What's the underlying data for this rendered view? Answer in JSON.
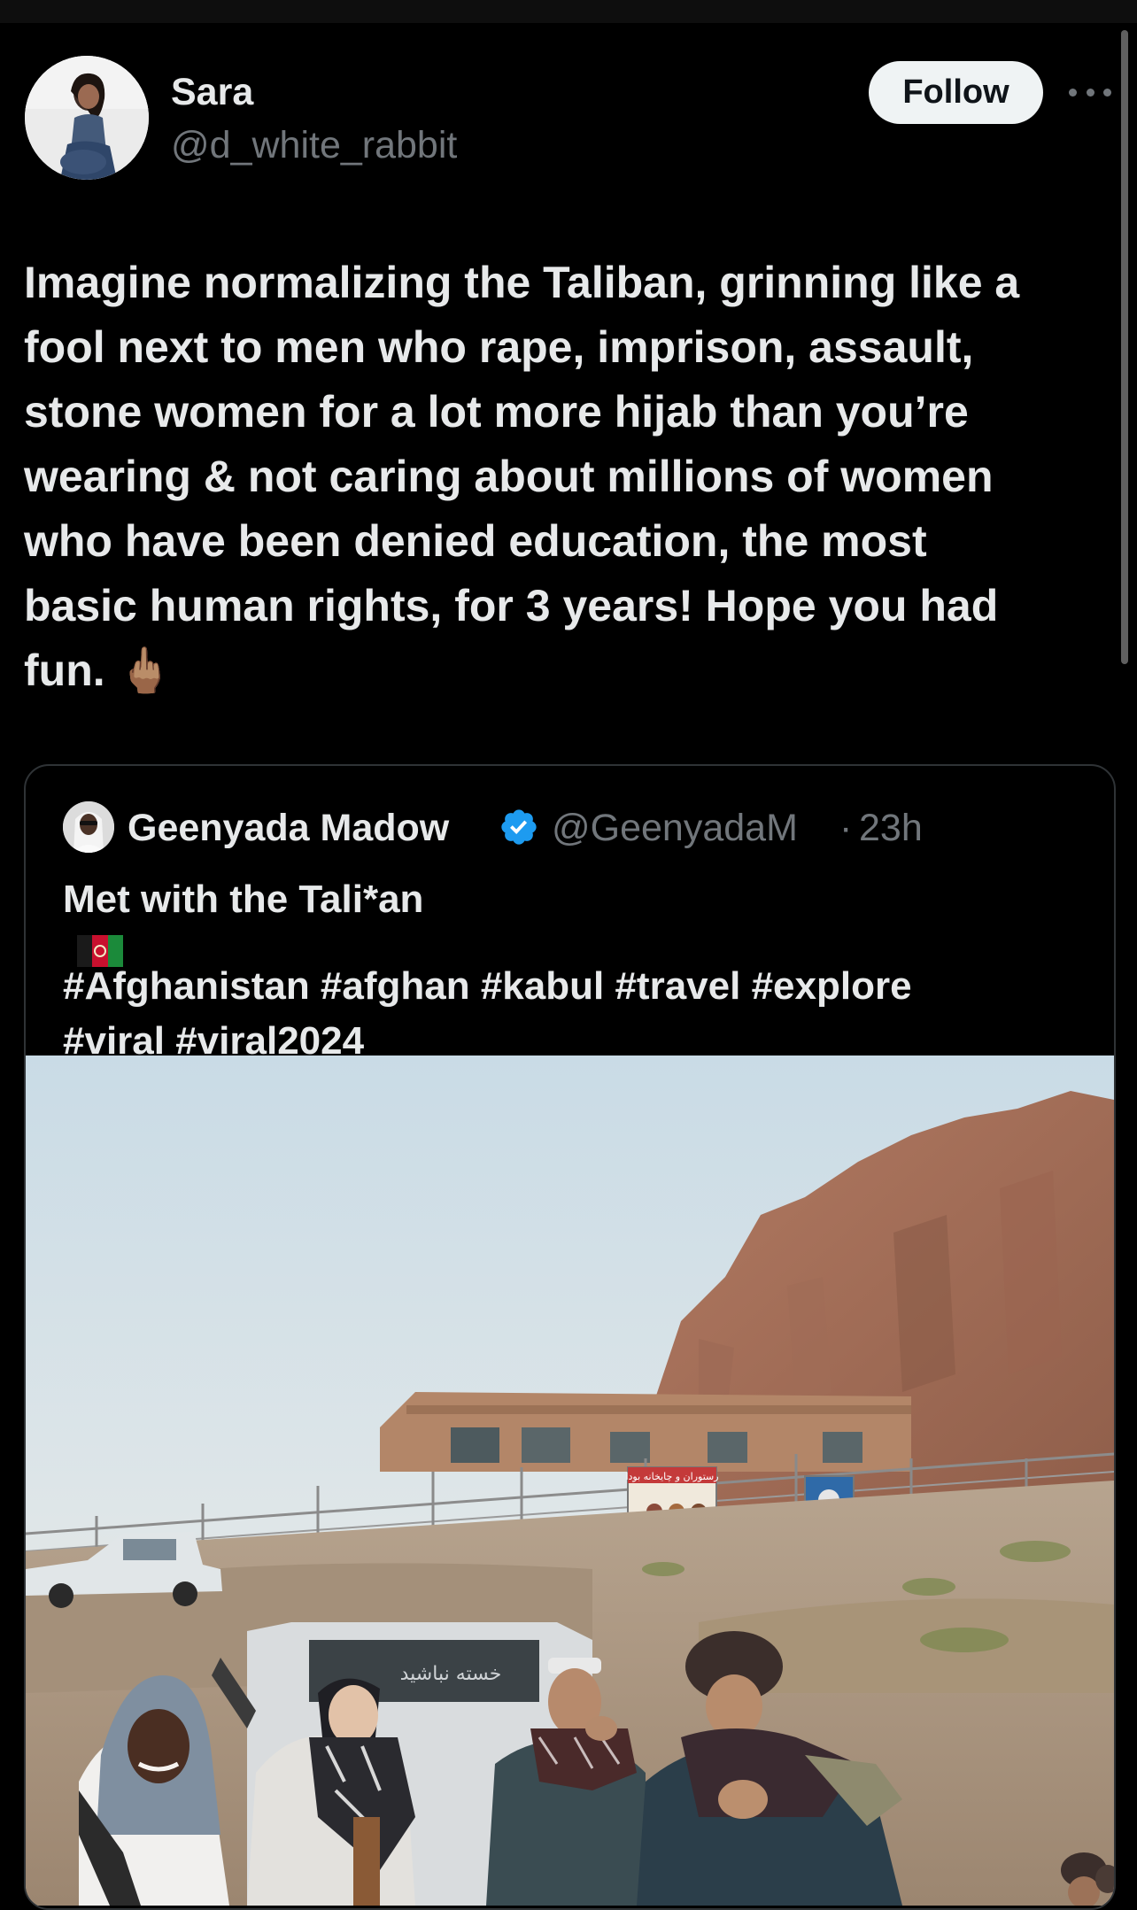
{
  "post": {
    "author": {
      "display_name": "Sara",
      "handle": "@d_white_rabbit"
    },
    "follow_label": "Follow",
    "text_lines": [
      "Imagine normalizing the Taliban, grinning like a",
      "fool next to men who rape, imprison, assault,",
      "stone women for a lot more hijab than you’re",
      "wearing & not caring about millions of women",
      "who have been denied education, the most",
      "basic human rights, for 3 years! Hope you had",
      "fun. 🖕🏽"
    ]
  },
  "quoted_post": {
    "author": {
      "display_name": "Geenyada Madow",
      "verified": true,
      "handle": "@GeenyadaM",
      "separator": "·",
      "time": "23h"
    },
    "text_lines": [
      "Met with the Tali*an",
      "#Afghanistan #afghan #kabul #travel #explore",
      "#viral #viral2024"
    ],
    "photo": {
      "banner_text": "رستوران و چایخانه بودا",
      "truck_text": "خسته نباشید"
    }
  },
  "colors": {
    "background": "#000000",
    "text_primary": "#e7e9ea",
    "text_secondary": "#71767b",
    "border": "#2f3336",
    "follow_bg": "#eff3f4",
    "verified_blue": "#1d9bf0"
  },
  "icons": {
    "more": "more-horizontal-icon",
    "verified": "verified-badge-icon",
    "flag": "afghanistan-flag-icon"
  }
}
